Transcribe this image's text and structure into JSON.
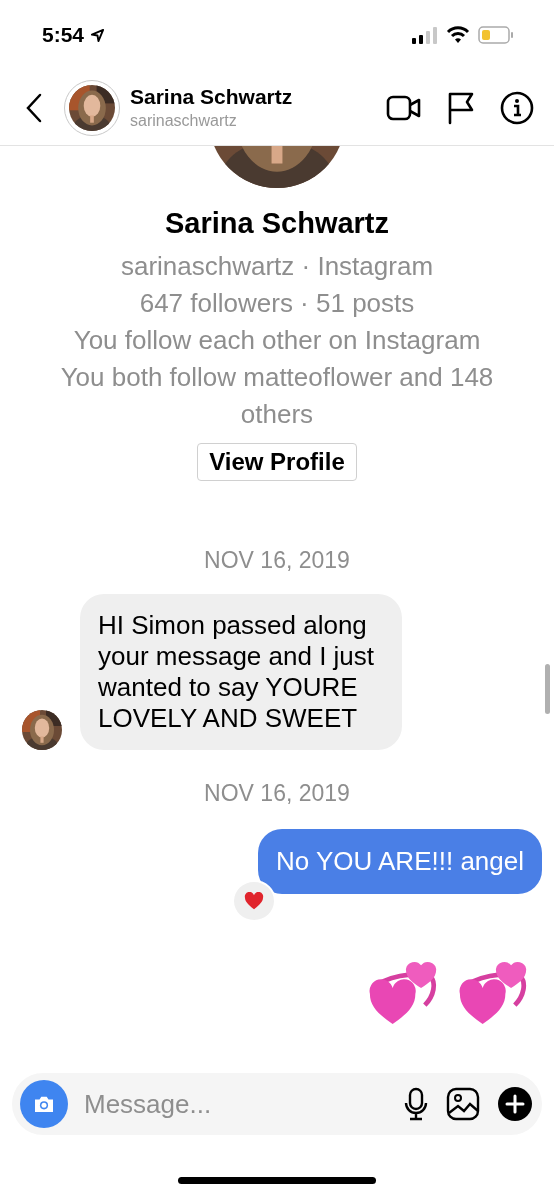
{
  "status_bar": {
    "time": "5:54"
  },
  "header": {
    "name": "Sarina Schwartz",
    "username": "sarinaschwartz"
  },
  "profile": {
    "name": "Sarina Schwartz",
    "lines": [
      "sarinaschwartz · Instagram",
      "647 followers · 51 posts",
      "You follow each other on Instagram",
      "You both follow matteoflower and 148 others"
    ],
    "button": "View Profile"
  },
  "messages": [
    {
      "kind": "date",
      "text": "NOV 16, 2019"
    },
    {
      "kind": "received",
      "text": "HI Simon passed along your message and I just wanted to say YOURE LOVELY AND SWEET"
    },
    {
      "kind": "date",
      "text": "NOV 16, 2019"
    },
    {
      "kind": "sent",
      "text": "No YOU ARE!!! angel",
      "reacted": true
    },
    {
      "kind": "stickers",
      "items": [
        {
          "kind": "revolving_hearts"
        },
        {
          "kind": "revolving_hearts"
        }
      ]
    }
  ],
  "composer": {
    "placeholder": "Message..."
  }
}
